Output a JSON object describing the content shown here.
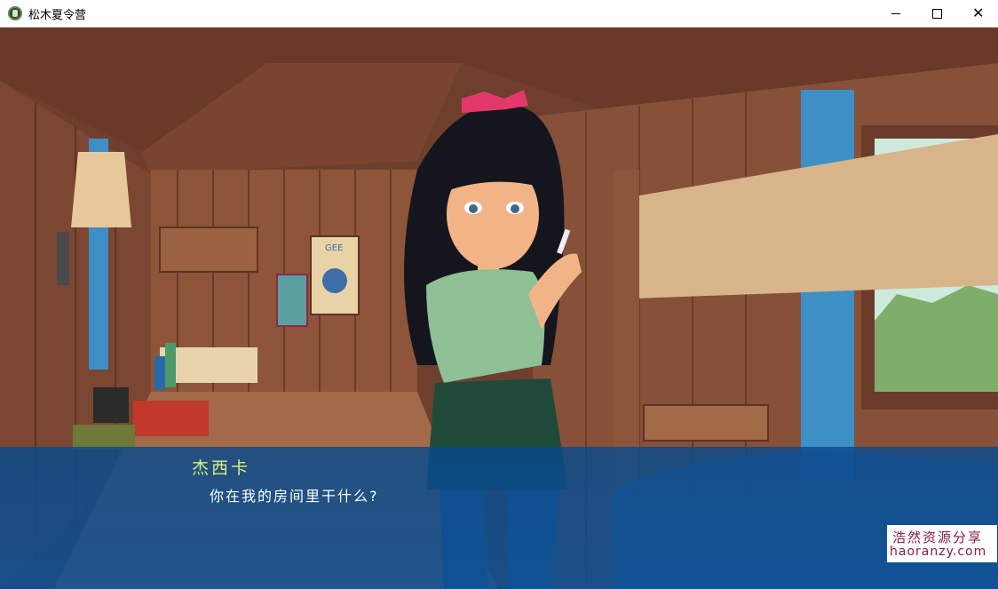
{
  "window": {
    "title": "松木夏令营",
    "minimize_symbol": "",
    "close_symbol": "✕"
  },
  "scene": {
    "poster_text": "GEE"
  },
  "dialog": {
    "speaker": "杰西卡",
    "line": "你在我的房间里干什么?"
  },
  "watermark": {
    "line1": "浩然资源分享",
    "line2": "haoranzy.com"
  },
  "colors": {
    "speaker": "#d8f07a",
    "dialog_bg": "#0a4f96",
    "wood": "#8a5238",
    "watermark_text": "#8a1a4a"
  }
}
